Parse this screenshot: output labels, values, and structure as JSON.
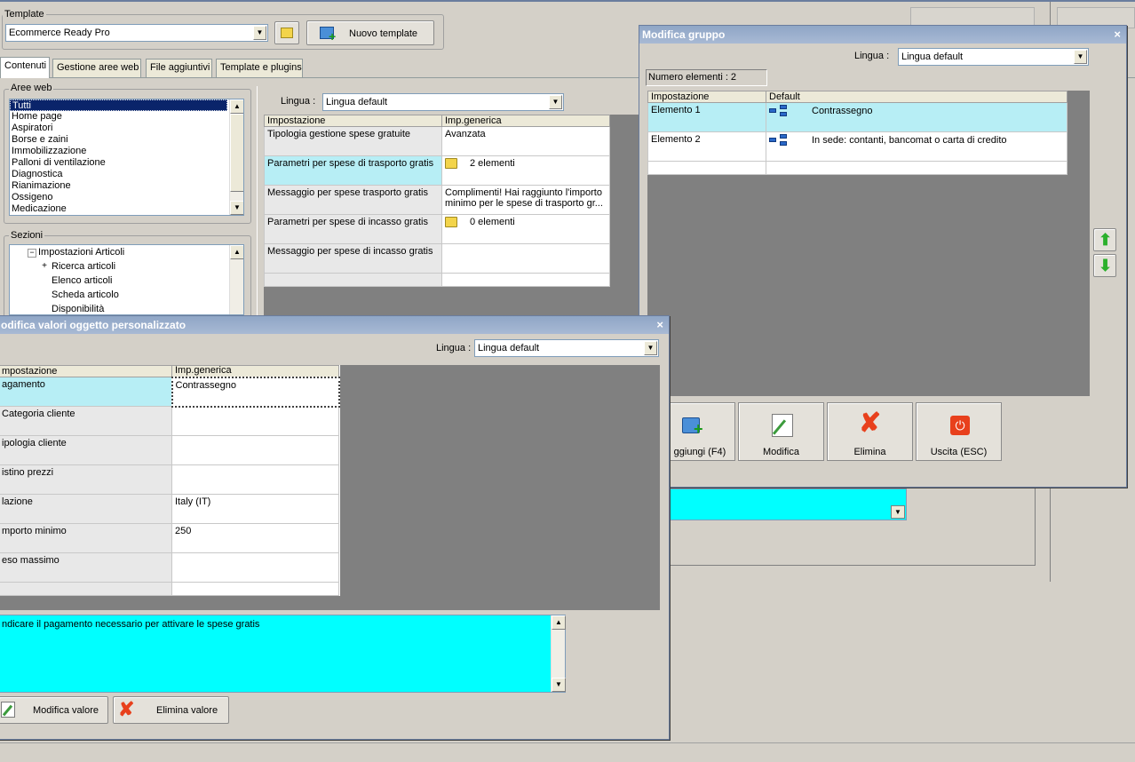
{
  "main": {
    "template_label": "Template",
    "template_value": "Ecommerce Ready Pro",
    "new_template_button": "Nuovo template",
    "tabs": [
      {
        "label": "Contenuti",
        "active": true
      },
      {
        "label": "Gestione aree web",
        "active": false
      },
      {
        "label": "File aggiuntivi",
        "active": false
      },
      {
        "label": "Template e plugins",
        "active": false
      }
    ],
    "aree_web": {
      "label": "Aree web",
      "items": [
        "Tutti",
        "Home page",
        "Aspiratori",
        "Borse e zaini",
        "Immobilizzazione",
        "Palloni di ventilazione",
        "Diagnostica",
        "Rianimazione",
        "Ossigeno",
        "Medicazione"
      ],
      "selected": "Tutti"
    },
    "sezioni": {
      "label": "Sezioni",
      "items": [
        "Impostazioni Articoli",
        "Ricerca articoli",
        "Elenco articoli",
        "Scheda articolo",
        "Disponibilità"
      ]
    },
    "lingua_label": "Lingua :",
    "lingua_value": "Lingua default",
    "grid": {
      "headers": [
        "Impostazione",
        "Imp.generica"
      ],
      "rows": [
        {
          "label": "Tipologia gestione spese gratuite",
          "value": "Avanzata"
        },
        {
          "label": "Parametri per spese di trasporto gratis",
          "value": "2 elementi",
          "icon": "folder-icon",
          "selected": true
        },
        {
          "label": "Messaggio per spese trasporto gratis",
          "value": "Complimenti! Hai raggiunto l'importo minimo per le spese di trasporto gr..."
        },
        {
          "label": "Parametri per spese di incasso gratis",
          "value": "0 elementi",
          "icon": "folder-icon"
        },
        {
          "label": "Messaggio per spese di incasso gratis",
          "value": ""
        }
      ]
    }
  },
  "dialog_valori": {
    "title": "odifica valori oggetto personalizzato",
    "lingua_label": "Lingua :",
    "lingua_value": "Lingua default",
    "headers": [
      "mpostazione",
      "Imp.generica"
    ],
    "rows": [
      {
        "label": "agamento",
        "value": "Contrassegno",
        "selected": true
      },
      {
        "label": "Categoria cliente",
        "value": ""
      },
      {
        "label": "ipologia cliente",
        "value": ""
      },
      {
        "label": "istino prezzi",
        "value": ""
      },
      {
        "label": "lazione",
        "value": "Italy (IT)"
      },
      {
        "label": "mporto minimo",
        "value": "250"
      },
      {
        "label": "eso massimo",
        "value": ""
      }
    ],
    "description": "ndicare il pagamento necessario per attivare le spese gratis",
    "modifica_button": "Modifica valore",
    "elimina_button": "Elimina valore"
  },
  "dialog_gruppo": {
    "title": "Modifica gruppo",
    "lingua_label": "Lingua :",
    "lingua_value": "Lingua default",
    "count_label": "Numero elementi : 2",
    "headers": [
      "Impostazione",
      "Default"
    ],
    "rows": [
      {
        "label": "Elemento 1",
        "value": "Contrassegno",
        "selected": true
      },
      {
        "label": "Elemento 2",
        "value": "In sede: contanti, bancomat o carta di credito"
      }
    ],
    "buttons": {
      "aggiungi": "ggiungi (F4)",
      "modifica": "Modifica",
      "elimina": "Elimina",
      "uscita": "Uscita (ESC)"
    }
  },
  "colors": {
    "selection_cyan": "#b7eef5",
    "description_cyan": "#00ffff",
    "list_selection": "#0a246a"
  }
}
